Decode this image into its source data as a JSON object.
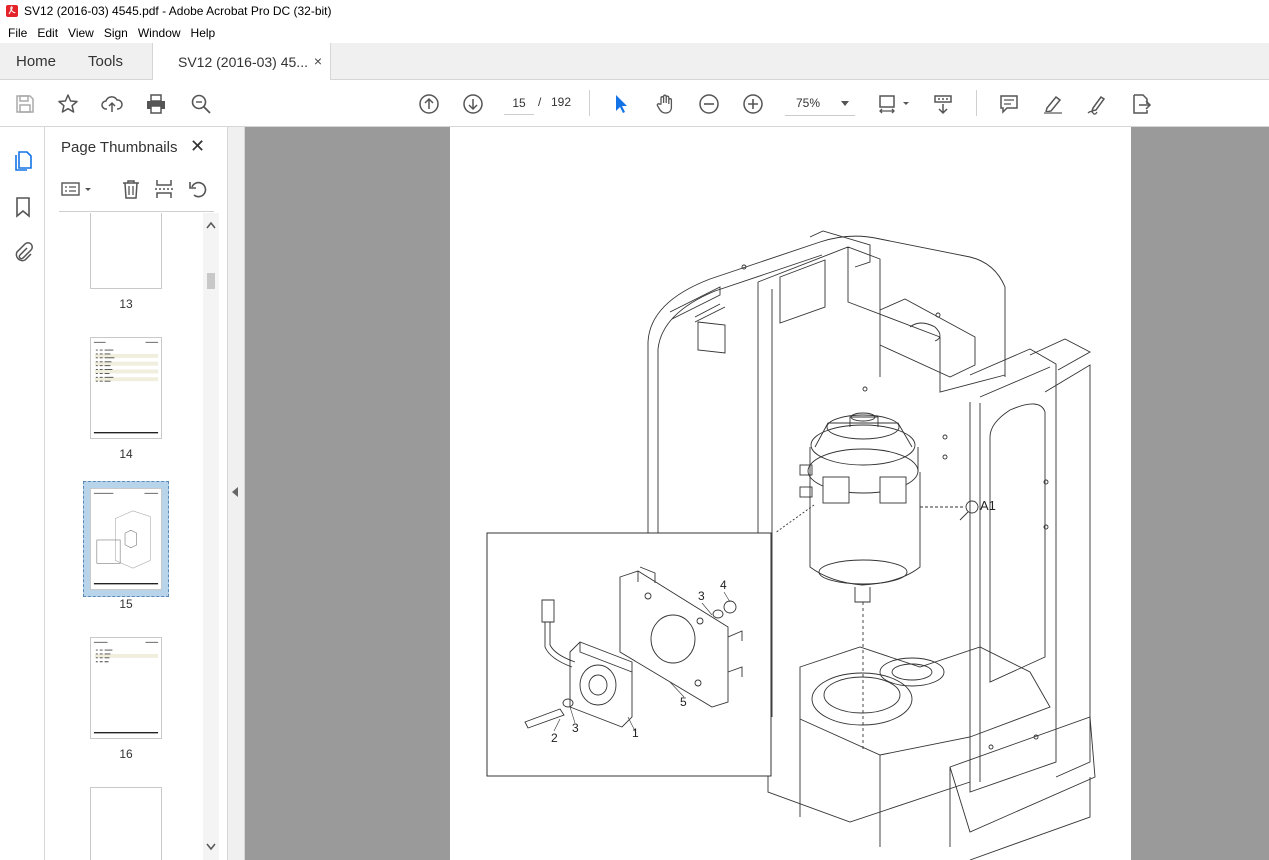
{
  "window": {
    "title": "SV12 (2016-03) 4545.pdf - Adobe Acrobat Pro DC (32-bit)"
  },
  "menu": [
    "File",
    "Edit",
    "View",
    "Sign",
    "Window",
    "Help"
  ],
  "tabs": {
    "home": "Home",
    "tools": "Tools",
    "document": "SV12 (2016-03) 45...",
    "close": "×"
  },
  "toolbar": {
    "current_page": "15",
    "page_separator": "/",
    "total_pages": "192",
    "zoom": "75%"
  },
  "thumbnails_panel": {
    "title": "Page Thumbnails",
    "close": "✕",
    "pages": [
      {
        "label": "13",
        "selected": false
      },
      {
        "label": "14",
        "selected": false
      },
      {
        "label": "15",
        "selected": true
      },
      {
        "label": "16",
        "selected": false
      }
    ]
  },
  "drawing": {
    "callouts": [
      "1",
      "2",
      "3",
      "3",
      "4",
      "5"
    ],
    "ref_label": "A1"
  },
  "colors": {
    "accent_blue": "#1473e6",
    "viewer_gray": "#9a9a9a",
    "selected_thumb": "#b8d4ea"
  },
  "icons": {
    "save": "save-icon",
    "bookmark": "bookmark-icon",
    "upload": "upload-icon",
    "print": "print-icon",
    "zoom": "zoom-search-icon",
    "prev": "arrow-up-circle-icon",
    "next": "arrow-down-circle-icon",
    "select": "pointer-icon",
    "hand": "hand-icon",
    "zoom_out": "minus-circle-icon",
    "zoom_in": "plus-circle-icon",
    "fit": "fit-page-icon",
    "scroll": "scroll-mode-icon",
    "comment": "comment-icon",
    "highlight": "highlight-pen-icon",
    "sign": "sign-icon",
    "export": "export-icon"
  }
}
